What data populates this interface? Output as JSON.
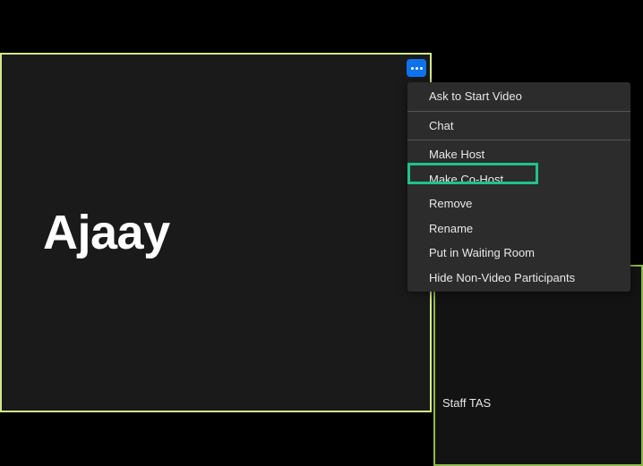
{
  "main_participant": {
    "name": "Ajaay"
  },
  "side_participant": {
    "label": "Staff TAS"
  },
  "menu": {
    "items": [
      {
        "label": "Ask to Start Video",
        "separator_after": true
      },
      {
        "label": "Chat",
        "separator_after": true
      },
      {
        "label": "Make Host",
        "separator_after": false
      },
      {
        "label": "Make Co-Host",
        "separator_after": false
      },
      {
        "label": "Remove",
        "separator_after": false
      },
      {
        "label": "Rename",
        "separator_after": false
      },
      {
        "label": "Put in Waiting Room",
        "separator_after": false
      },
      {
        "label": "Hide Non-Video Participants",
        "separator_after": false
      }
    ]
  }
}
